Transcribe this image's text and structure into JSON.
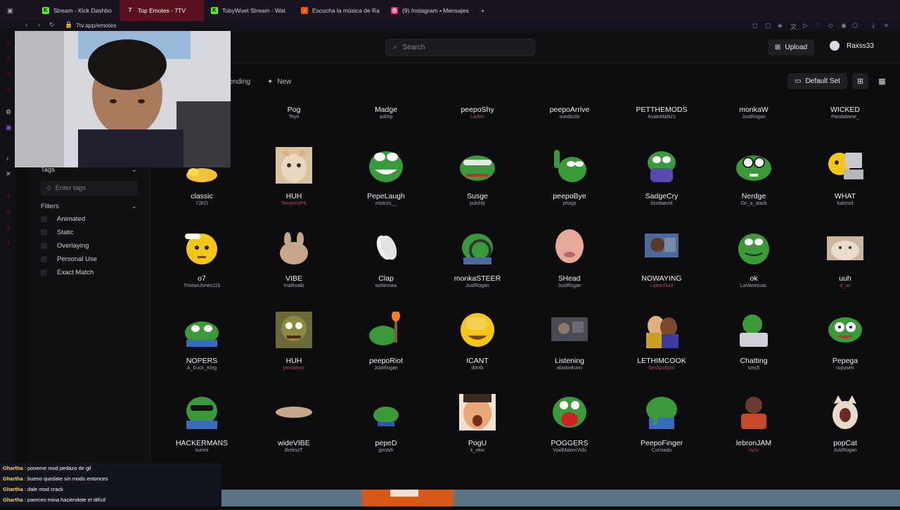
{
  "browser": {
    "tabs": [
      {
        "label": "Stream - Kick Dashbo",
        "color": "#53fc18",
        "icon": "kick-icon"
      },
      {
        "label": "Top Emotes - 7TV",
        "color": "#ffffff",
        "icon": "7tv-icon",
        "active": true
      },
      {
        "label": "TobyWuet Stream - Wat",
        "color": "#53fc18",
        "icon": "kick-icon"
      },
      {
        "label": "Escucha la música de Ra",
        "color": "#ff5500",
        "icon": "music-icon"
      },
      {
        "label": "(9) Instagram • Mensajes",
        "color": "#e1306c",
        "icon": "instagram-icon"
      }
    ],
    "new_tab": "+",
    "url": "7tv.app/emotes"
  },
  "header": {
    "search_placeholder": "Search",
    "upload_label": "Upload",
    "username": "Raxss33"
  },
  "subbar": {
    "trending_label": "ending",
    "new_label": "New",
    "default_set_label": "Default Set"
  },
  "sidebar": {
    "tags_label": "Tags",
    "tags_placeholder": "Enter tags",
    "filters_label": "Filters",
    "filters": [
      "Animated",
      "Static",
      "Overlaying",
      "Personal Use",
      "Exact Match"
    ]
  },
  "emotes": {
    "row0": [
      {
        "name": "Pog",
        "author": "Teyn"
      },
      {
        "name": "Madge",
        "author": "askhp"
      },
      {
        "name": "peepoShy",
        "author": "Laden",
        "colored": true
      },
      {
        "name": "peepoArrive",
        "author": "sundizzle"
      },
      {
        "name": "PETTHEMODS",
        "author": "AsianMaNz1"
      },
      {
        "name": "monkaW",
        "author": "JustRogan"
      },
      {
        "name": "WICKED",
        "author": "Pandabene_"
      }
    ],
    "row1": [
      {
        "name": "classic",
        "author": "7JEO"
      },
      {
        "name": "HUH",
        "author": "TemperzPK",
        "colored": true
      },
      {
        "name": "PepeLaugh",
        "author": "mistrzu__"
      },
      {
        "name": "Susge",
        "author": "pulshly"
      },
      {
        "name": "peepoBye",
        "author": "phayp"
      },
      {
        "name": "SadgeCry",
        "author": "itzzdaavid"
      },
      {
        "name": "Nerdge",
        "author": "On_a_stack"
      },
      {
        "name": "WHAT",
        "author": "kalorxd"
      }
    ],
    "row2": [
      {
        "name": "o7",
        "author": "TristianJones116"
      },
      {
        "name": "VIBE",
        "author": "mathvaib"
      },
      {
        "name": "Clap",
        "author": "turtlemaw"
      },
      {
        "name": "monkaSTEER",
        "author": "JustRogan"
      },
      {
        "name": "5Head",
        "author": "JustRogan"
      },
      {
        "name": "NOWAYING",
        "author": "LiptonGod",
        "colored": true
      },
      {
        "name": "ok",
        "author": "LaVanessaL"
      },
      {
        "name": "uuh",
        "author": "d_uc",
        "colored": true
      }
    ],
    "row3": [
      {
        "name": "NOPERS",
        "author": "A_Duck_King"
      },
      {
        "name": "HUH",
        "author": "pentalexx",
        "colored": true
      },
      {
        "name": "peepoRiot",
        "author": "JustRogan"
      },
      {
        "name": "ICANT",
        "author": "dor4k"
      },
      {
        "name": "Listening",
        "author": "alastorkunn"
      },
      {
        "name": "LETHIMCOOK",
        "author": "SerApollyon",
        "colored": true
      },
      {
        "name": "Chatting",
        "author": "smc5"
      },
      {
        "name": "Pepega",
        "author": "rupusen"
      }
    ],
    "row4": [
      {
        "name": "HACKERMANS",
        "author": "numrii"
      },
      {
        "name": "wideVIBE",
        "author": "BrekszT"
      },
      {
        "name": "pepeD",
        "author": "gentvh"
      },
      {
        "name": "PogU",
        "author": "k_ekw"
      },
      {
        "name": "POGGERS",
        "author": "VoidMakesVids"
      },
      {
        "name": "PeepoFinger",
        "author": "Coroiado"
      },
      {
        "name": "lebronJAM",
        "author": "hyru",
        "colored": true
      },
      {
        "name": "popCat",
        "author": "JustRogan"
      }
    ]
  },
  "chat": [
    {
      "user": "Ghartha",
      "text": " : poneme mod pedazo de gil"
    },
    {
      "user": "Ghartha",
      "text": " : bueno quedate sin mods entonces"
    },
    {
      "user": "Ghartha",
      "text": " : dale mod crack"
    },
    {
      "user": "Ghartha",
      "text": " : pareces mina haciendote el difícil"
    }
  ],
  "colors": {
    "accent": "#5a1020",
    "pepe_green": "#3a9a3a",
    "author_colored": "#b34b6a"
  }
}
